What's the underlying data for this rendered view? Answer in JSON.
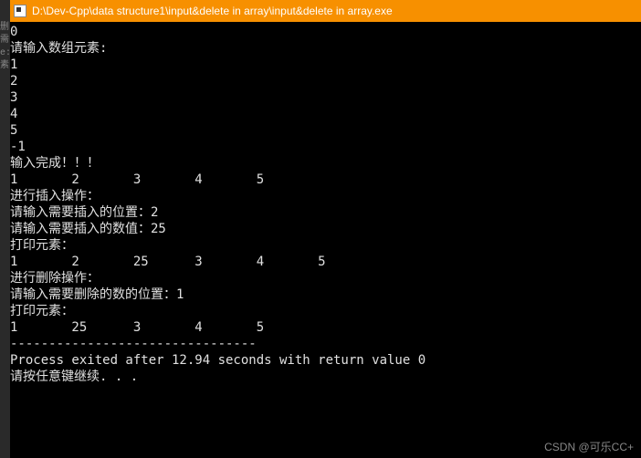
{
  "titlebar": {
    "path": "D:\\Dev-Cpp\\data structure1\\input&delete in array\\input&delete in array.exe"
  },
  "leftstrip": {
    "chars": [
      "",
      "",
      "",
      "",
      "删",
      "需",
      "",
      "e:",
      "",
      "",
      "",
      "",
      "",
      "素"
    ]
  },
  "console": {
    "lines": [
      "0",
      "请输入数组元素:",
      "1",
      "2",
      "3",
      "4",
      "5",
      "-1",
      "输入完成！！！",
      "1       2       3       4       5",
      "进行插入操作：",
      "请输入需要插入的位置：2",
      "请输入需要插入的数值：25",
      "打印元素：",
      "1       2       25      3       4       5",
      "进行删除操作：",
      "请输入需要删除的数的位置：1",
      "打印元素：",
      "1       25      3       4       5",
      "--------------------------------",
      "Process exited after 12.94 seconds with return value 0",
      "请按任意键继续. . ."
    ]
  },
  "watermark": {
    "text": "CSDN @可乐CC+"
  }
}
